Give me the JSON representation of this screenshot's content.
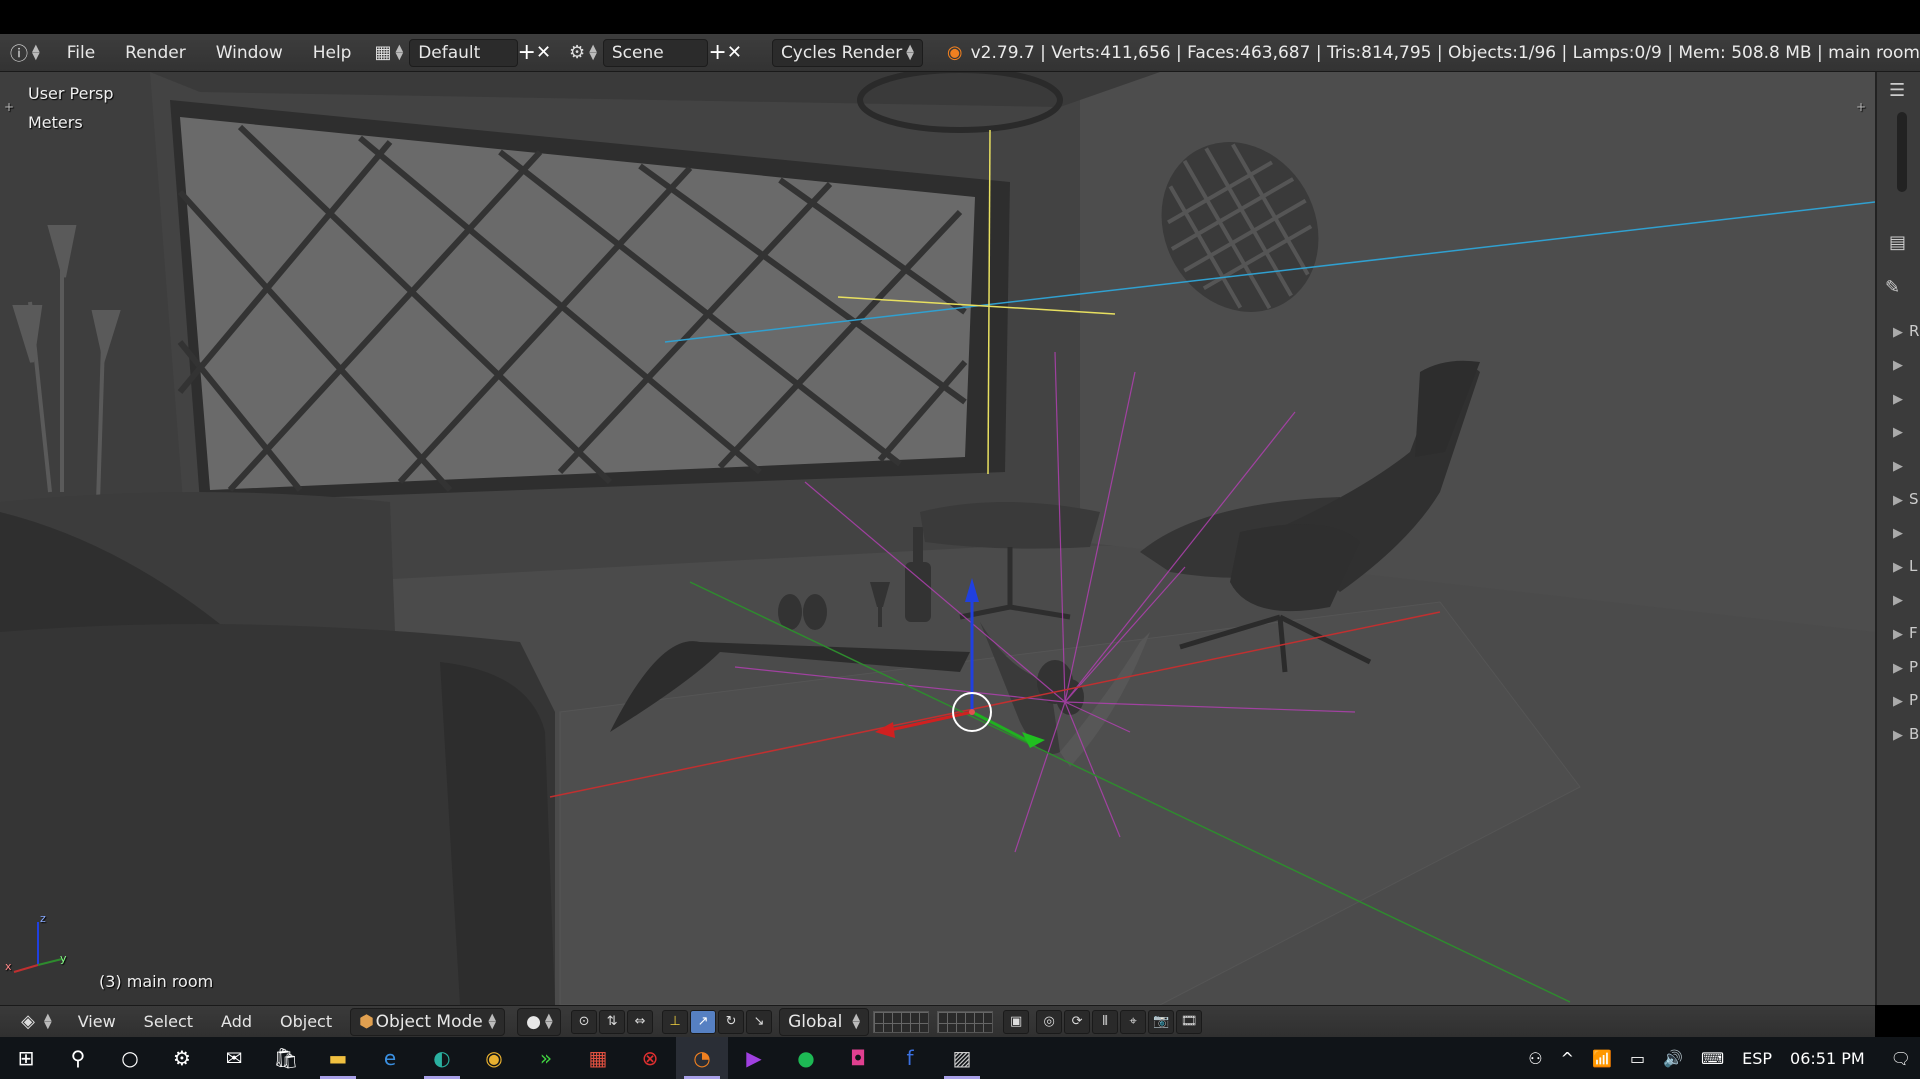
{
  "topbar": {
    "menus": [
      "File",
      "Render",
      "Window",
      "Help"
    ],
    "layout_dropdown": "Default",
    "scene_dropdown": "Scene",
    "engine_dropdown": "Cycles Render",
    "stats": "v2.79.7 | Verts:411,656 | Faces:463,687 | Tris:814,795 | Objects:1/96 | Lamps:0/9 | Mem: 508.8 MB | main room",
    "plus_symbol": "+",
    "close_symbol": "✕"
  },
  "viewport": {
    "view_name": "User Persp",
    "units": "Meters",
    "object_label": "(3) main room",
    "axis_x": "x",
    "axis_y": "y",
    "axis_z": "z"
  },
  "right_panel": {
    "letters": [
      "R",
      "",
      "",
      "",
      "",
      "S",
      "",
      "L",
      "",
      "F",
      "P",
      "P",
      "B"
    ]
  },
  "bottombar": {
    "menus": [
      "View",
      "Select",
      "Add",
      "Object"
    ],
    "mode_dropdown": "Object Mode",
    "orientation_dropdown": "Global"
  },
  "taskbar": {
    "language": "ESP",
    "time": "06:51 PM"
  },
  "colors": {
    "viewport_bg": "#474747",
    "x_axis": "#c03030",
    "y_axis": "#2e8b2e",
    "z_axis": "#2040e0",
    "lamp_lines": "#b040b0",
    "camera_line": "#30a0d0",
    "cursor_line": "#e8e060"
  }
}
